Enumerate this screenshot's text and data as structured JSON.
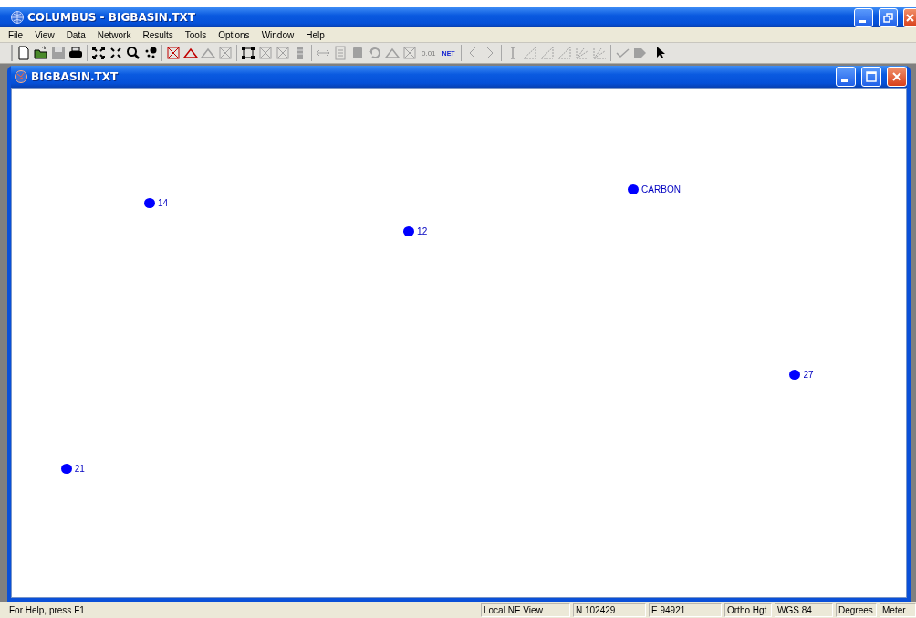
{
  "window": {
    "title": "COLUMBUS - BIGBASIN.TXT"
  },
  "menu": [
    "File",
    "View",
    "Data",
    "Network",
    "Results",
    "Tools",
    "Options",
    "Window",
    "Help"
  ],
  "toolbar": [
    [
      {
        "kind": "new",
        "disabled": false
      },
      {
        "kind": "open",
        "disabled": false
      },
      {
        "kind": "save",
        "disabled": true
      },
      {
        "kind": "print",
        "disabled": false
      }
    ],
    [
      {
        "kind": "expand",
        "disabled": false
      },
      {
        "kind": "shrink",
        "disabled": false
      },
      {
        "kind": "magnifier",
        "disabled": false
      },
      {
        "kind": "dots",
        "disabled": false
      }
    ],
    [
      {
        "kind": "crossbox",
        "disabled": false
      },
      {
        "kind": "triangle",
        "disabled": false
      },
      {
        "kind": "triangle",
        "disabled": true
      },
      {
        "kind": "crossbox",
        "disabled": true
      }
    ],
    [
      {
        "kind": "nodes",
        "disabled": false
      },
      {
        "kind": "crossbox",
        "disabled": true
      },
      {
        "kind": "crossbox",
        "disabled": true
      },
      {
        "kind": "stack",
        "disabled": true
      }
    ],
    [
      {
        "kind": "arrows",
        "disabled": true
      },
      {
        "kind": "doc",
        "disabled": true
      },
      {
        "kind": "block",
        "disabled": true
      },
      {
        "kind": "rotate",
        "disabled": true
      },
      {
        "kind": "triangle",
        "disabled": true
      },
      {
        "kind": "crossbox",
        "disabled": true
      },
      {
        "kind": "text",
        "text": "0.01",
        "disabled": true
      },
      {
        "kind": "text",
        "text": "NET",
        "disabled": false
      }
    ],
    [
      {
        "kind": "left",
        "disabled": true
      },
      {
        "kind": "right",
        "disabled": true
      }
    ],
    [
      {
        "kind": "ibeam",
        "disabled": true
      },
      {
        "kind": "angle",
        "disabled": true
      },
      {
        "kind": "angle",
        "disabled": true
      },
      {
        "kind": "angle",
        "disabled": true
      },
      {
        "kind": "fan",
        "disabled": true
      },
      {
        "kind": "fan",
        "disabled": true
      }
    ],
    [
      {
        "kind": "check",
        "disabled": true
      },
      {
        "kind": "pentagon",
        "disabled": true
      }
    ],
    [
      {
        "kind": "helppointer",
        "disabled": false
      }
    ]
  ],
  "child_window": {
    "title": "BIGBASIN.TXT"
  },
  "points": [
    {
      "label": "14"
    },
    {
      "label": "12"
    },
    {
      "label": "CARBON"
    },
    {
      "label": "27"
    },
    {
      "label": "21"
    }
  ],
  "status_bar": {
    "hint": "For Help, press F1",
    "panes": [
      "Local NE View",
      "N 102429",
      "E 94921",
      "Ortho Hgt",
      "WGS 84",
      "Degrees",
      "Meter"
    ]
  }
}
